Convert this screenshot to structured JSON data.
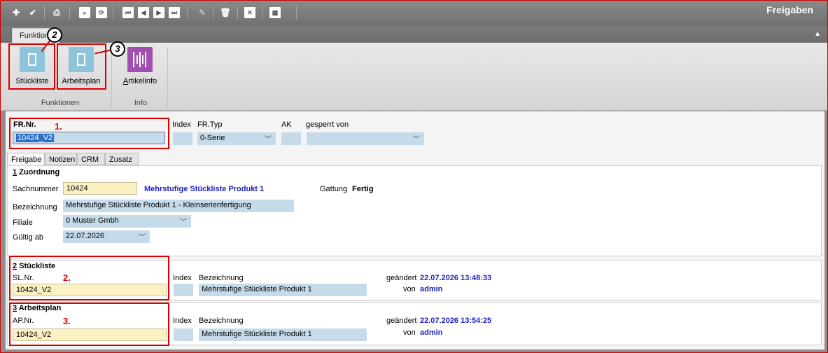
{
  "window": {
    "title": "Freigaben"
  },
  "toolbar": {
    "buttons": [
      {
        "name": "new-icon",
        "glyph": "✚"
      },
      {
        "name": "check-icon",
        "glyph": "✔"
      },
      {
        "name": "print-icon",
        "glyph": "⎙"
      },
      {
        "name": "search-icon",
        "glyph": "⌕"
      },
      {
        "name": "refresh-icon",
        "glyph": "⟳"
      },
      {
        "name": "first-icon",
        "glyph": "⏮"
      },
      {
        "name": "prev-icon",
        "glyph": "◀"
      },
      {
        "name": "next-icon",
        "glyph": "▶"
      },
      {
        "name": "last-icon",
        "glyph": "⏭"
      },
      {
        "name": "edit-icon",
        "glyph": "✎"
      },
      {
        "name": "delete-icon",
        "glyph": "🗑"
      },
      {
        "name": "cancel-icon",
        "glyph": "✕"
      },
      {
        "name": "grid-icon",
        "glyph": "▦"
      }
    ]
  },
  "ribbon": {
    "tab_label": "Funktionen",
    "buttons": {
      "stueckliste": "Stückliste",
      "arbeitsplan": "Arbeitsplan",
      "artikelinfo_first": "A",
      "artikelinfo_rest": "rtikelinfo"
    },
    "groups": {
      "funktionen": "Funktionen",
      "info": "Info"
    },
    "badges": {
      "b2": "2",
      "b3": "3"
    }
  },
  "header": {
    "fr_nr_label": "FR.Nr.",
    "fr_nr_value": "10424_V2",
    "marker1": "1.",
    "index_label": "Index",
    "fr_typ_label": "FR.Typ",
    "fr_typ_value": "0-Serie",
    "ak_label": "AK",
    "gesperrt_label": "gesperrt von",
    "gesperrt_value": ""
  },
  "subtabs": [
    "Freigabe",
    "Notizen",
    "CRM",
    "Zusatz"
  ],
  "zuordnung": {
    "title_num": "1",
    "title_rest": " Zuordnung",
    "sachnummer_label": "Sachnummer",
    "sachnummer_value": "10424",
    "sachnummer_desc": "Mehrstufige Stückliste Produkt 1",
    "gattung_label": "Gattung",
    "gattung_value": "Fertig",
    "bezeichnung_label": "Bezeichnung",
    "bezeichnung_value": "Mehrstufige Stückliste Produkt 1 - Kleinserienfertigung",
    "filiale_label": "Filiale",
    "filiale_value": "0  Muster Gmbh",
    "gueltig_label": "Gültig ab",
    "gueltig_value": "22.07.2026"
  },
  "stueckliste": {
    "title_num": "2",
    "title_rest": " Stückliste",
    "nr_label": "SL.Nr.",
    "nr_value": "10424_V2",
    "marker": "2.",
    "index_label": "Index",
    "bez_label": "Bezeichnung",
    "bez_value": "Mehrstufige Stückliste Produkt 1",
    "geaendert_label": "geändert",
    "geaendert_value": "22.07.2026 13:48:33",
    "von_label": "von",
    "von_value": "admin"
  },
  "arbeitsplan": {
    "title_num": "3",
    "title_rest": " Arbeitsplan",
    "nr_label": "AP.Nr.",
    "nr_value": "10424_V2",
    "marker": "3.",
    "index_label": "Index",
    "bez_label": "Bezeichnung",
    "bez_value": "Mehrstufige Stückliste Produkt 1",
    "geaendert_label": "geändert",
    "geaendert_value": "22.07.2026 13:54:25",
    "von_label": "von",
    "von_value": "admin"
  },
  "colors": {
    "highlight": "#d90000",
    "link_blue": "#1f22c4",
    "field_blue": "#c6dbea",
    "field_yellow": "#fcf1c3"
  }
}
